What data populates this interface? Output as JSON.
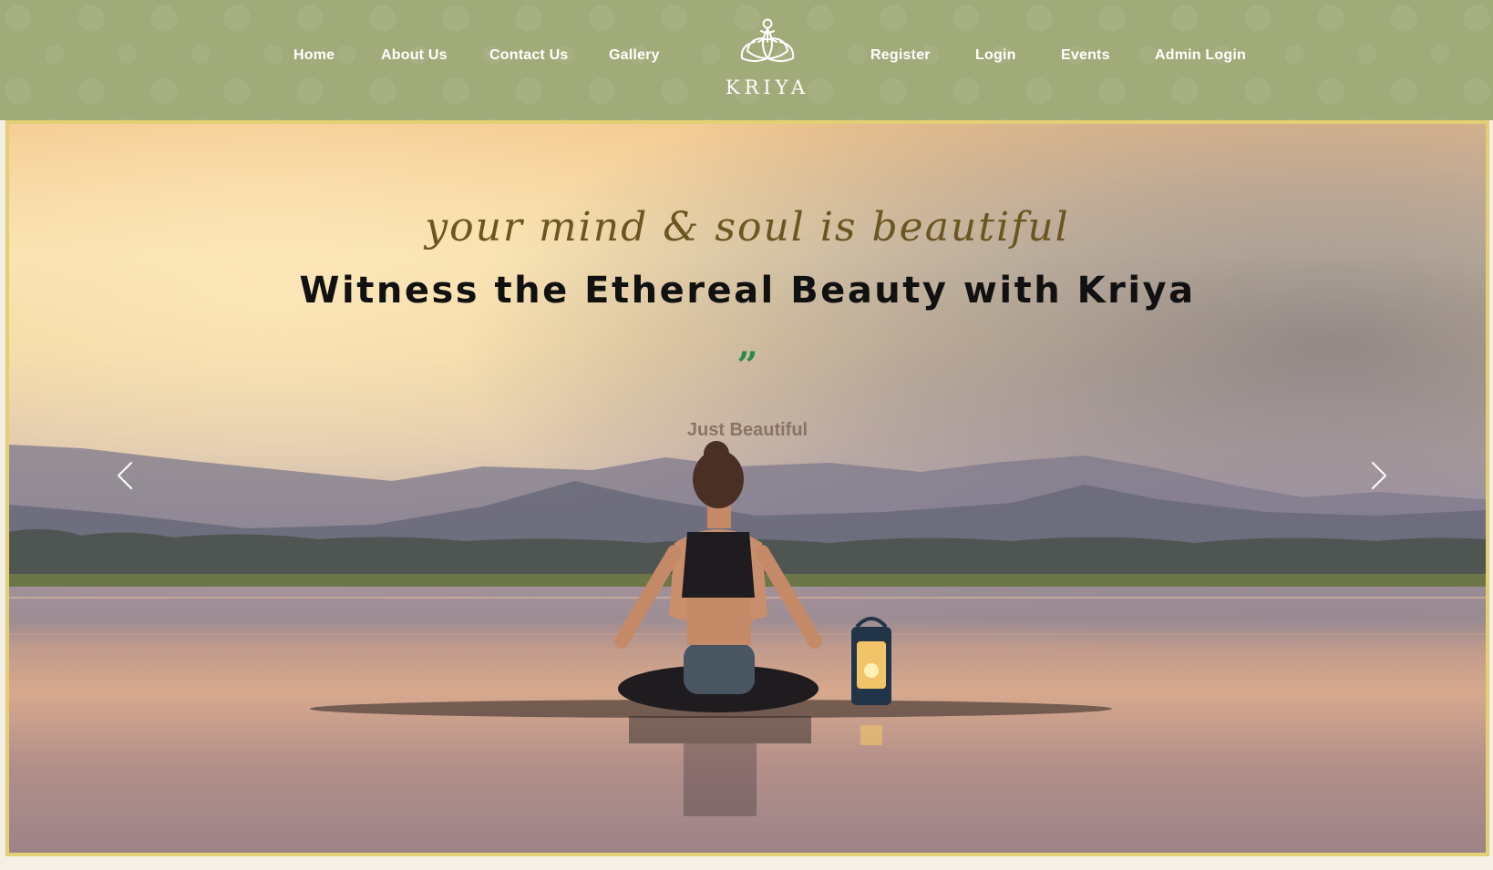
{
  "nav": {
    "left_items": [
      "Home",
      "About Us",
      "Contact Us",
      "Gallery"
    ],
    "right_items": [
      "Register",
      "Login",
      "Events",
      "Admin Login"
    ]
  },
  "logo": {
    "text": "KRIYA",
    "icon": "lotus-meditation-icon"
  },
  "hero": {
    "tagline": "your mind & soul is beautiful",
    "headline": "Witness the Ethereal Beauty with Kriya",
    "quote_icon": "”",
    "subtext": "Just Beautiful",
    "prev_icon": "chevron-left-icon",
    "next_icon": "chevron-right-icon"
  },
  "colors": {
    "header_bg": "#a1ab79",
    "frame_border": "#e3cf74",
    "quote_green": "#2b8a4a",
    "tagline": "#6b5520"
  }
}
